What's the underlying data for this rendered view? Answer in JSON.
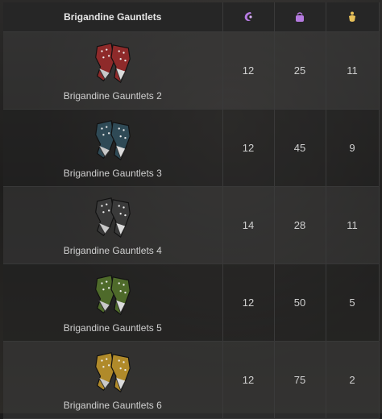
{
  "header": {
    "title": "Brigandine Gauntlets",
    "icons": [
      "magic-resist-icon",
      "weight-bag-icon",
      "gold-value-icon"
    ]
  },
  "rows": [
    {
      "name": "Brigandine Gauntlets 2",
      "color": "#8e2a2a",
      "v1": "12",
      "v2": "25",
      "v3": "11"
    },
    {
      "name": "Brigandine Gauntlets 3",
      "color": "#2f4a56",
      "v1": "12",
      "v2": "45",
      "v3": "9"
    },
    {
      "name": "Brigandine Gauntlets 4",
      "color": "#3a3a3a",
      "v1": "14",
      "v2": "28",
      "v3": "11"
    },
    {
      "name": "Brigandine Gauntlets 5",
      "color": "#4e6a2a",
      "v1": "12",
      "v2": "50",
      "v3": "5"
    },
    {
      "name": "Brigandine Gauntlets 6",
      "color": "#b08a2a",
      "v1": "12",
      "v2": "75",
      "v3": "2"
    }
  ],
  "colors": {
    "icon_purple": "#b57ae0",
    "icon_gold": "#e8c15a"
  }
}
